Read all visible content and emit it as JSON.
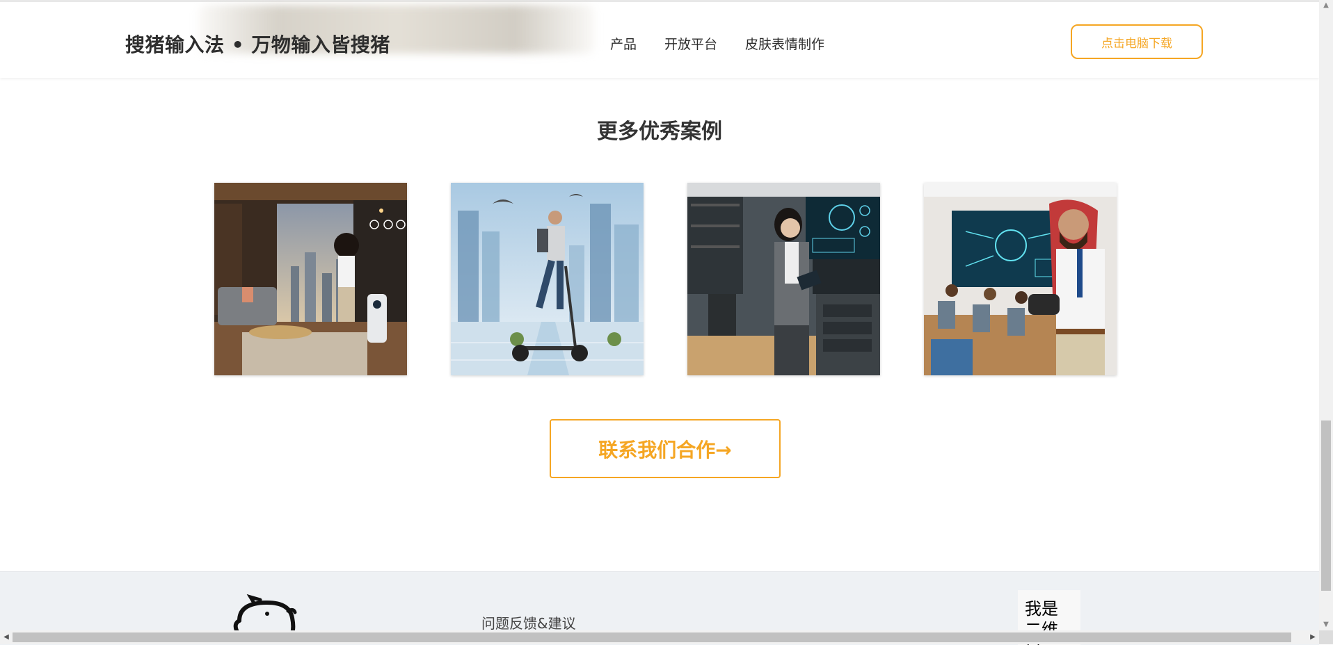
{
  "header": {
    "brand": "搜猪输入法 • 万物输入皆搜猪",
    "nav": [
      {
        "label": "产品"
      },
      {
        "label": "开放平台"
      },
      {
        "label": "皮肤表情制作"
      }
    ],
    "download_label": "点击电脑下载"
  },
  "main": {
    "section_title": "更多优秀案例",
    "contact_label": "联系我们合作→"
  },
  "footer": {
    "feedback_link": "问题反馈&建议",
    "qr_text": "我是二维码"
  },
  "colors": {
    "accent": "#f5a623",
    "footer_bg": "#eef1f4",
    "text_dark": "#2d2d2d"
  },
  "icons": {
    "footer_logo": "pig-logo-icon",
    "scroll_up": "triangle-up-icon",
    "scroll_down": "triangle-down-icon",
    "scroll_left": "triangle-left-icon",
    "scroll_right": "triangle-right-icon"
  }
}
